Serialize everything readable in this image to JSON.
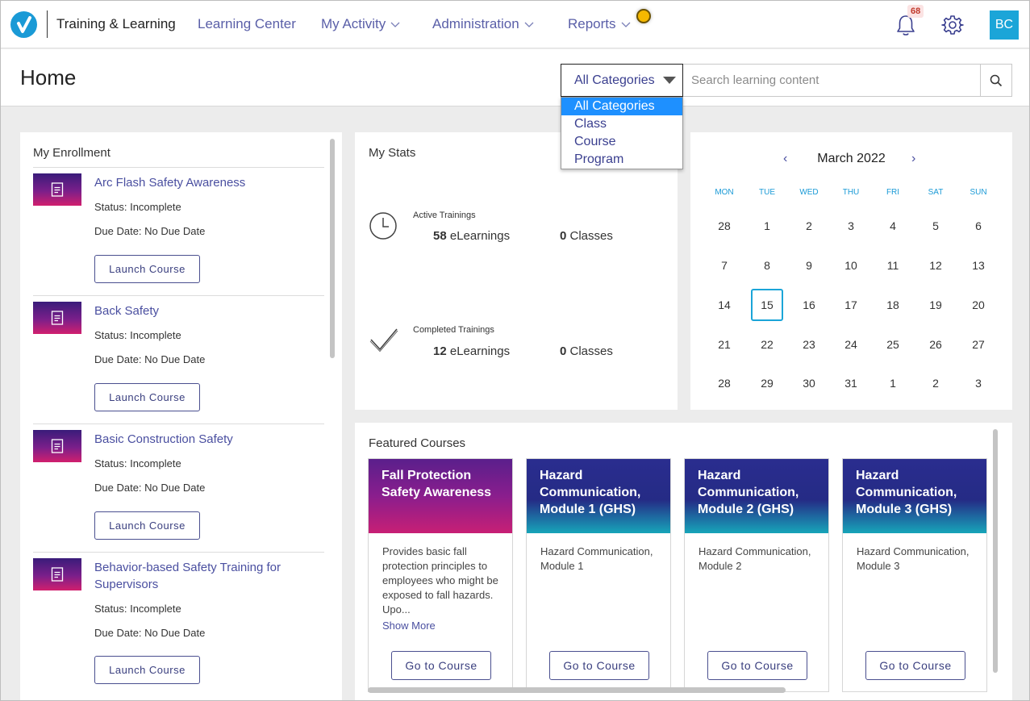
{
  "app": {
    "title": "Training & Learning",
    "nav": [
      "Learning Center",
      "My Activity",
      "Administration",
      "Reports"
    ],
    "notification_count": "68",
    "avatar_initials": "BC",
    "brand_color": "#1a9ad6"
  },
  "page": {
    "title": "Home",
    "category_selected": "All Categories",
    "category_options": [
      "All Categories",
      "Class",
      "Course",
      "Program"
    ],
    "search_placeholder": "Search learning content"
  },
  "enrollment": {
    "title": "My Enrollment",
    "status_label": "Status:",
    "due_label": "Due Date:",
    "launch_label": "Launch Course",
    "items": [
      {
        "name": "Arc Flash Safety Awareness",
        "status": "Incomplete",
        "due": "No Due Date"
      },
      {
        "name": "Back Safety",
        "status": "Incomplete",
        "due": "No Due Date"
      },
      {
        "name": "Basic Construction Safety",
        "status": "Incomplete",
        "due": "No Due Date"
      },
      {
        "name": "Behavior-based Safety Training for Supervisors",
        "status": "Incomplete",
        "due": "No Due Date"
      }
    ]
  },
  "stats": {
    "title": "My Stats",
    "active_label": "Active Trainings",
    "active_elearnings_num": "58",
    "active_elearnings_unit": "eLearnings",
    "active_classes_num": "0",
    "active_classes_unit": "Classes",
    "completed_label": "Completed Trainings",
    "completed_elearnings_num": "12",
    "completed_elearnings_unit": "eLearnings",
    "completed_classes_num": "0",
    "completed_classes_unit": "Classes"
  },
  "calendar": {
    "month": "March 2022",
    "prev": "‹",
    "next": "›",
    "weekdays": [
      "MON",
      "TUE",
      "WED",
      "THU",
      "FRI",
      "SAT",
      "SUN"
    ],
    "weeks": [
      [
        "28",
        "1",
        "2",
        "3",
        "4",
        "5",
        "6"
      ],
      [
        "7",
        "8",
        "9",
        "10",
        "11",
        "12",
        "13"
      ],
      [
        "14",
        "15",
        "16",
        "17",
        "18",
        "19",
        "20"
      ],
      [
        "21",
        "22",
        "23",
        "24",
        "25",
        "26",
        "27"
      ],
      [
        "28",
        "29",
        "30",
        "31",
        "1",
        "2",
        "3"
      ]
    ],
    "today": "15"
  },
  "featured": {
    "title": "Featured Courses",
    "go_label": "Go to Course",
    "cards": [
      {
        "title": "Fall Protection Safety Awareness",
        "desc": "Provides basic fall protection principles to employees who might be exposed to fall hazards. Upo...",
        "show_more": "Show More"
      },
      {
        "title": "Hazard Communication, Module 1 (GHS)",
        "desc": "Hazard Communication, Module 1"
      },
      {
        "title": "Hazard Communication, Module 2 (GHS)",
        "desc": "Hazard Communication, Module 2"
      },
      {
        "title": "Hazard Communication, Module 3 (GHS)",
        "desc": "Hazard Communication, Module 3"
      }
    ]
  }
}
